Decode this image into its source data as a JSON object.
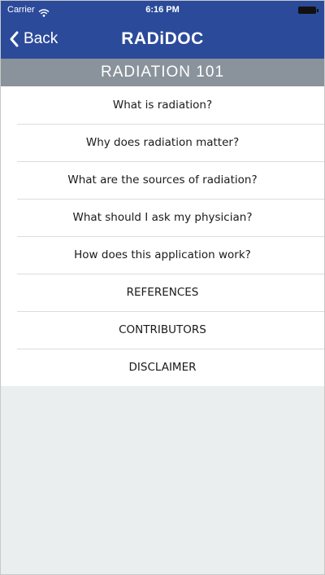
{
  "status_bar": {
    "carrier": "Carrier",
    "time": "6:16 PM"
  },
  "nav": {
    "back_label": "Back",
    "app_title": "RADiDOC"
  },
  "section": {
    "title": "RADIATION 101"
  },
  "menu": {
    "items": [
      {
        "label": "What is radiation?"
      },
      {
        "label": "Why does radiation matter?"
      },
      {
        "label": "What are the sources of radiation?"
      },
      {
        "label": "What should I ask my physician?"
      },
      {
        "label": "How does this application work?"
      },
      {
        "label": "REFERENCES"
      },
      {
        "label": "CONTRIBUTORS"
      },
      {
        "label": "DISCLAIMER"
      }
    ]
  },
  "colors": {
    "nav_blue": "#2b4a9a",
    "section_gray": "#8a939b",
    "background": "#ebeeef"
  }
}
